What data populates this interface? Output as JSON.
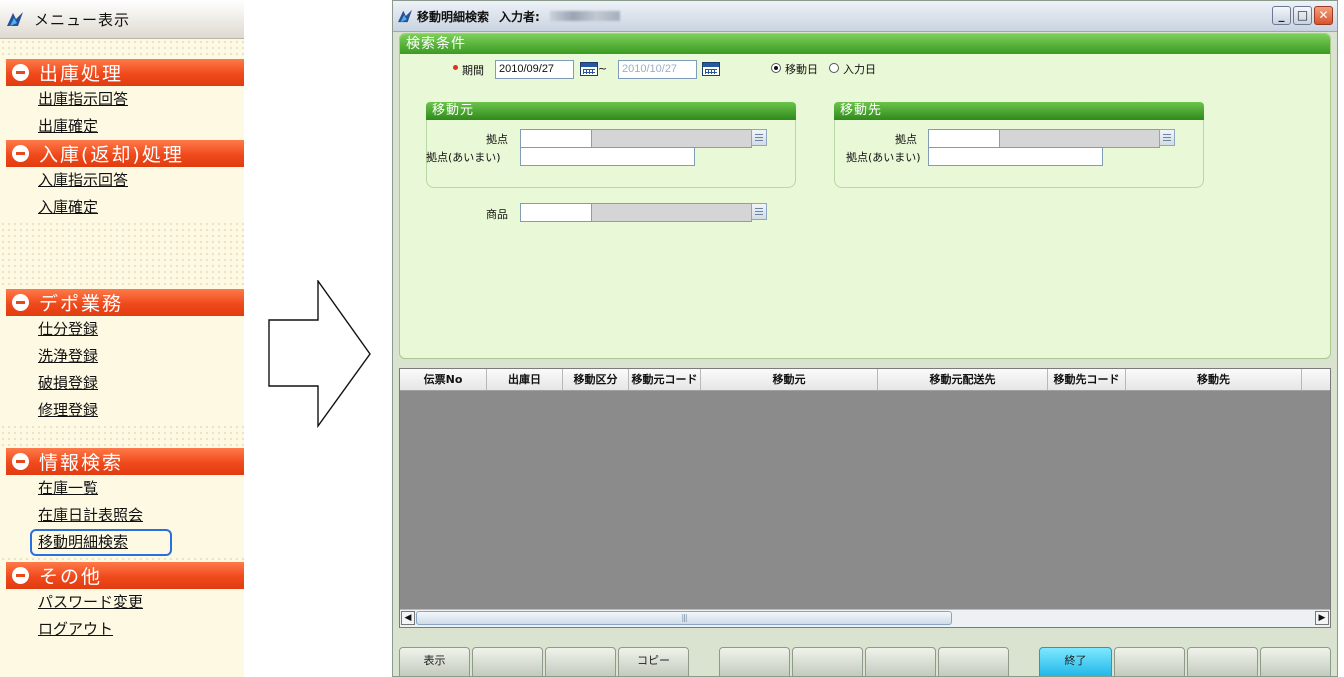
{
  "menu": {
    "title": "メニュー表示",
    "sections": [
      {
        "label": "出庫処理",
        "items": [
          "出庫指示回答",
          "出庫確定"
        ]
      },
      {
        "label": "入庫(返却)処理",
        "items": [
          "入庫指示回答",
          "入庫確定"
        ]
      },
      {
        "label": "デポ業務",
        "items": [
          "仕分登録",
          "洗浄登録",
          "破損登録",
          "修理登録"
        ]
      },
      {
        "label": "情報検索",
        "items": [
          "在庫一覧",
          "在庫日計表照会",
          "移動明細検索"
        ]
      },
      {
        "label": "その他",
        "items": [
          "パスワード変更",
          "ログアウト"
        ]
      }
    ],
    "selected": "移動明細検索"
  },
  "window": {
    "title": "移動明細検索",
    "user_label": "入力者:",
    "colors": {
      "panel_header": "#3a9a22",
      "accent_button": "#22b8e8",
      "menu_header": "#f04a1c"
    }
  },
  "search": {
    "header": "検索条件",
    "period_label": "期間",
    "date_from": "2010/09/27",
    "tilde": "~",
    "date_to": "2010/10/27",
    "radio_options": [
      "移動日",
      "入力日"
    ],
    "radio_selected": "移動日",
    "source": {
      "header": "移動元",
      "base_label": "拠点",
      "base_fuzzy_label": "拠点(あいまい)"
    },
    "destination": {
      "header": "移動先",
      "base_label": "拠点",
      "base_fuzzy_label": "拠点(あいまい)"
    },
    "product_label": "商品"
  },
  "grid": {
    "columns": [
      "伝票No",
      "出庫日",
      "移動区分",
      "移動元コード",
      "移動元",
      "移動元配送先",
      "移動先コード",
      "移動先"
    ]
  },
  "footer": {
    "buttons": [
      "表示",
      "",
      "",
      "コピー",
      "",
      "",
      "",
      "",
      "",
      "終了",
      "",
      "",
      ""
    ],
    "accent_index": 9
  }
}
